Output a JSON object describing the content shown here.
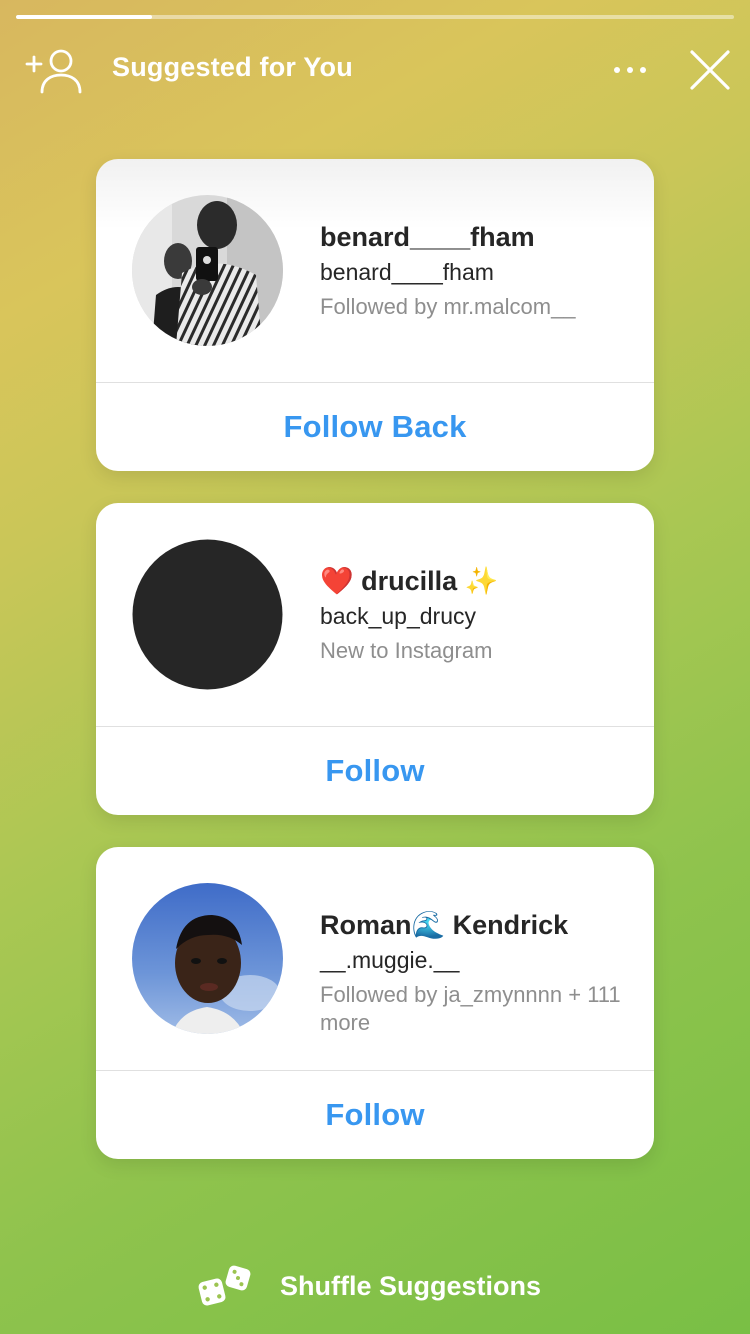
{
  "story": {
    "progress_fraction": 0.19
  },
  "header": {
    "title": "Suggested for You",
    "add_user_icon": "add-user-icon",
    "more_icon": "more-horizontal-icon",
    "close_icon": "close-icon"
  },
  "suggestions": [
    {
      "name": "benard____fham",
      "username": "benard____fham",
      "context": "Followed by mr.malcom__",
      "button_label": "Follow Back",
      "avatar": "photo-avatar"
    },
    {
      "name": "❤️ drucilla ✨",
      "username": "back_up_drucy",
      "context": "New to Instagram",
      "button_label": "Follow",
      "avatar": "dark-circle-avatar"
    },
    {
      "name": "Roman🌊 Kendrick",
      "username": "__.muggie.__",
      "context": "Followed by ja_zmynnnn + 111 more",
      "button_label": "Follow",
      "avatar": "photo-avatar"
    }
  ],
  "footer": {
    "shuffle_label": "Shuffle Suggestions",
    "shuffle_icon": "dice-icon"
  },
  "colors": {
    "link_blue": "#3897f0",
    "secondary_text": "#8e8e8e",
    "primary_text": "#262626"
  }
}
